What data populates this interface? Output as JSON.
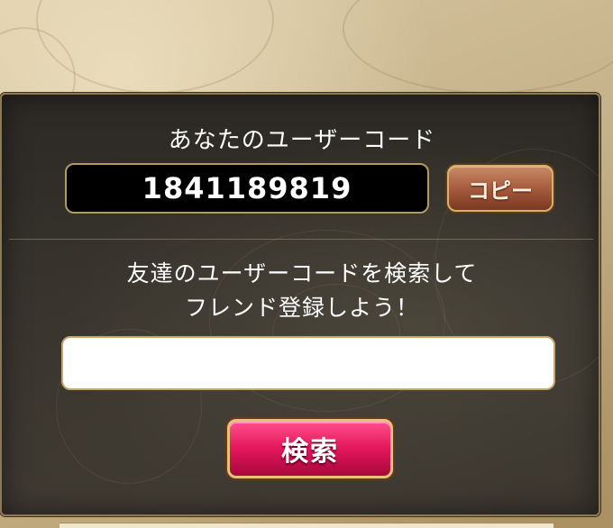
{
  "my_code": {
    "title": "あなたのユーザーコード",
    "value": "1841189819",
    "copy_label": "コピー"
  },
  "friend_search": {
    "instruction_line1": "友達のユーザーコードを検索して",
    "instruction_line2": "フレンド登録しよう！",
    "input_value": "",
    "search_label": "検索"
  },
  "colors": {
    "panel_bg": "#33302a",
    "copy_button": "#a3583a",
    "search_button": "#e3165c",
    "gold_border": "#d8b26a"
  }
}
